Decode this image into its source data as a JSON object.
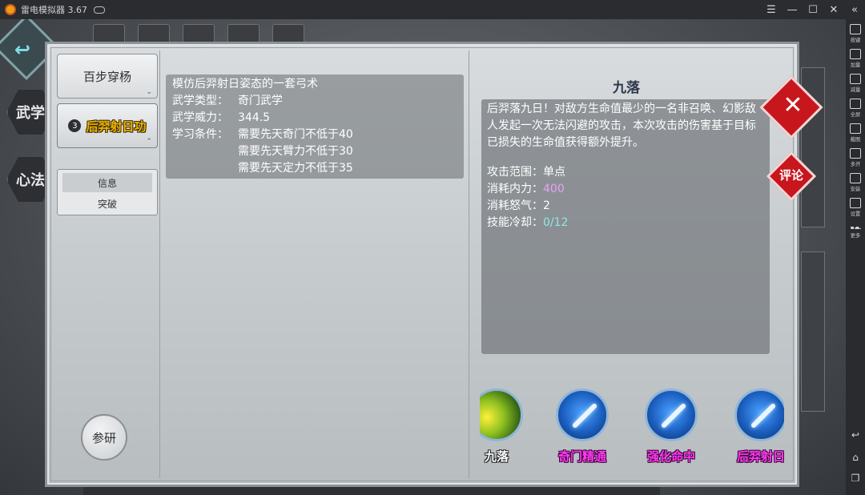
{
  "window": {
    "title": "雷电模拟器 3.67"
  },
  "emulator_sidebar": {
    "items": [
      {
        "label": "按键",
        "icon": "keyboard-icon"
      },
      {
        "label": "加量",
        "icon": "volume-up-icon"
      },
      {
        "label": "减量",
        "icon": "volume-down-icon"
      },
      {
        "label": "全屏",
        "icon": "fullscreen-icon"
      },
      {
        "label": "截图",
        "icon": "scissors-icon"
      },
      {
        "label": "多开",
        "icon": "multi-instance-icon"
      },
      {
        "label": "安装",
        "icon": "apk-install-icon"
      },
      {
        "label": "设置",
        "icon": "gear-icon"
      },
      {
        "label": "更多",
        "icon": "more-icon"
      }
    ]
  },
  "left_nav": {
    "wuxue": "武学",
    "xinfa": "心法"
  },
  "skill_tabs": [
    {
      "label": "百步穿杨"
    },
    {
      "badge": "3",
      "label": "后羿射日功"
    }
  ],
  "submenu": {
    "info": "信息",
    "breakthrough": "突破"
  },
  "research_button": "参研",
  "info": {
    "title": "模仿后羿射日姿态的一套弓术",
    "type_label": "武学类型：",
    "type_value": "奇门武学",
    "power_label": "武学威力：",
    "power_value": "344.5",
    "req_label": "学习条件：",
    "req_1": "需要先天奇门不低于40",
    "req_2": "需要先天臂力不低于30",
    "req_3": "需要先天定力不低于35"
  },
  "skill_detail": {
    "name": "九落",
    "description": "后羿落九日！对敌方生命值最少的一名非召唤、幻影敌人发起一次无法闪避的攻击，本次攻击的伤害基于目标已损失的生命值获得额外提升。",
    "range_label": "攻击范围：",
    "range_value": "单点",
    "mp_label": "消耗内力：",
    "mp_value": "400",
    "rage_label": "消耗怒气：",
    "rage_value": "2",
    "cd_label": "技能冷却：",
    "cd_value": "0/12"
  },
  "skill_icons": [
    {
      "label": "九落"
    },
    {
      "label": "奇门精通"
    },
    {
      "label": "强化命中"
    },
    {
      "label": "后羿射日"
    }
  ],
  "buttons": {
    "close": "✕",
    "comment": "评论"
  }
}
